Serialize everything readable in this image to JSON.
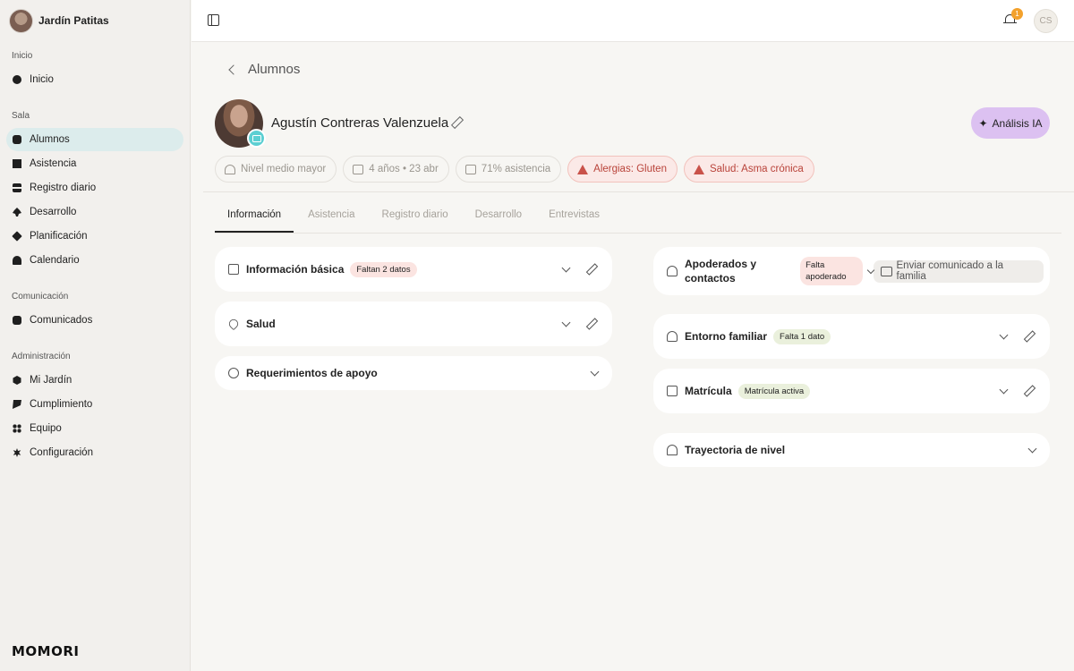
{
  "brand": {
    "name": "Jardín Patitas"
  },
  "logo_text": "MOMORI",
  "sidebar": {
    "sections": [
      {
        "label": "Inicio",
        "items": [
          {
            "label": "Inicio",
            "icon": "circle-icon"
          }
        ]
      },
      {
        "label": "Sala",
        "items": [
          {
            "label": "Alumnos",
            "icon": "square-icon",
            "active": true
          },
          {
            "label": "Asistencia",
            "icon": "grid-icon"
          },
          {
            "label": "Registro diario",
            "icon": "bars-icon"
          },
          {
            "label": "Desarrollo",
            "icon": "club-icon"
          },
          {
            "label": "Planificación",
            "icon": "diamond-icon"
          },
          {
            "label": "Calendario",
            "icon": "arch-icon"
          }
        ]
      },
      {
        "label": "Comunicación",
        "items": [
          {
            "label": "Comunicados",
            "icon": "square-icon"
          }
        ]
      },
      {
        "label": "Administración",
        "items": [
          {
            "label": "Mi Jardín",
            "icon": "hexagon-icon"
          },
          {
            "label": "Cumplimiento",
            "icon": "flag-icon"
          },
          {
            "label": "Equipo",
            "icon": "dots-icon"
          },
          {
            "label": "Configuración",
            "icon": "gear-icon"
          }
        ]
      }
    ]
  },
  "topbar": {
    "notification_count": "1",
    "user_initials": "CS"
  },
  "header": {
    "back_label": "Alumnos",
    "student_name": "Agustín Contreras Valenzuela",
    "ai_button": "Análisis IA"
  },
  "chips": {
    "level": "Nivel medio mayor",
    "age": "4 años • 23 abr",
    "attendance": "71% asistencia",
    "allergy": "Alergias: Gluten",
    "health": "Salud: Asma crónica"
  },
  "tabs": [
    "Información",
    "Asistencia",
    "Registro diario",
    "Desarrollo",
    "Entrevistas"
  ],
  "left_cards": {
    "basic": {
      "title": "Información básica",
      "tag": "Faltan 2 datos"
    },
    "health": {
      "title": "Salud"
    },
    "support": {
      "title": "Requerimientos de apoyo"
    }
  },
  "right_cards": {
    "guardians": {
      "title": "Apoderados y contactos",
      "tag": "Falta apoderado",
      "send_button": "Enviar comunicado a la familia"
    },
    "family": {
      "title": "Entorno familiar",
      "tag": "Falta 1 dato"
    },
    "enrollment": {
      "title": "Matrícula",
      "tag": "Matrícula activa"
    },
    "trajectory": {
      "title": "Trayectoria de nivel"
    }
  }
}
